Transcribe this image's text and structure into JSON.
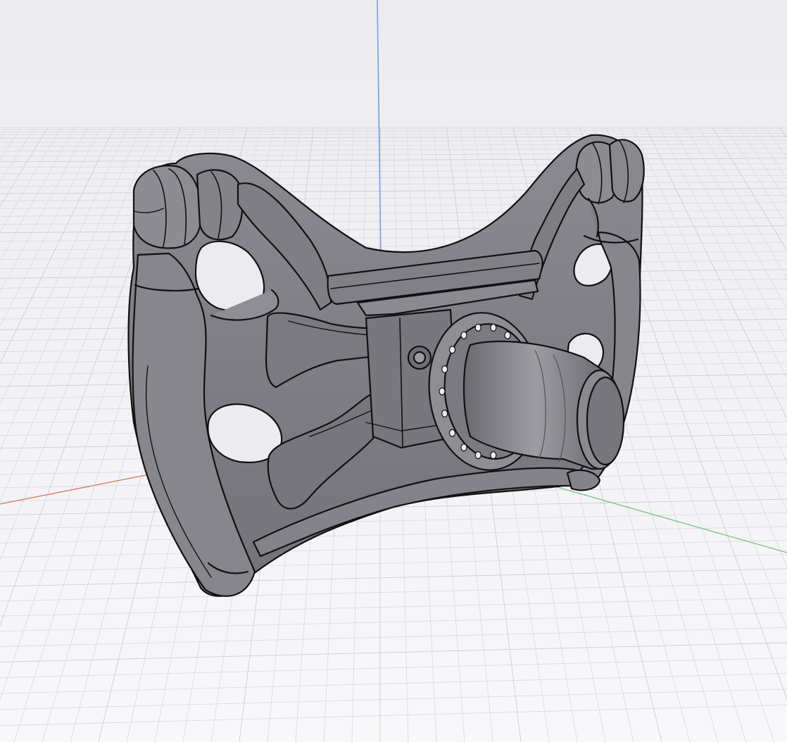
{
  "viewport": {
    "view_mode": "shaded-with-edges",
    "grid": true,
    "axes": [
      "x",
      "y",
      "z"
    ]
  },
  "colors": {
    "background_top": "#ececef",
    "background_bottom": "#f8f8fa",
    "grid_minor": "#d9d9de",
    "grid_major": "#c8c8ce",
    "axis_x": "#e07a6e",
    "axis_y": "#7fc58a",
    "axis_z": "#6aa3f0",
    "model_fill": "#7c7c82",
    "model_fill_light": "#9a9aa0",
    "model_fill_dark": "#5a5a60",
    "model_edge": "#111111"
  },
  "model": {
    "object": "steering-wheel"
  }
}
